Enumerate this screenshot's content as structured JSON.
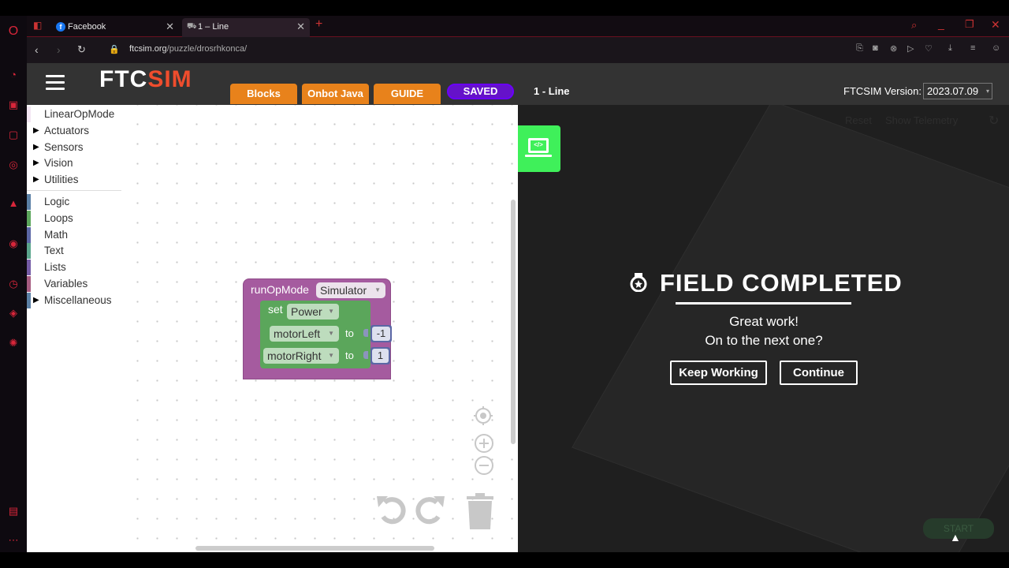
{
  "browser": {
    "tabs": [
      {
        "title": "Facebook"
      },
      {
        "title": "1 – Line"
      }
    ],
    "url_domain": "ftcsim.org",
    "url_path": "/puzzle/drosrhkonca/"
  },
  "header": {
    "logo_main": "FTC",
    "logo_accent": "SIM",
    "tabs": [
      "Blocks",
      "Onbot Java",
      "GUIDE"
    ],
    "saved_label": "SAVED",
    "level_title": "1 - Line",
    "version_label": "FTCSIM Version:",
    "version_value": "2023.07.09"
  },
  "toolbox": {
    "categories": [
      {
        "label": "LinearOpMode",
        "expandable": false,
        "color": "#f3e6f3"
      },
      {
        "label": "Actuators",
        "expandable": true,
        "color": ""
      },
      {
        "label": "Sensors",
        "expandable": true,
        "color": ""
      },
      {
        "label": "Vision",
        "expandable": true,
        "color": ""
      },
      {
        "label": "Utilities",
        "expandable": true,
        "color": ""
      },
      {
        "label": "Logic",
        "expandable": false,
        "color": "#5b80a5"
      },
      {
        "label": "Loops",
        "expandable": false,
        "color": "#5ba55b"
      },
      {
        "label": "Math",
        "expandable": false,
        "color": "#5b67a5"
      },
      {
        "label": "Text",
        "expandable": false,
        "color": "#5ba58c"
      },
      {
        "label": "Lists",
        "expandable": false,
        "color": "#745ba5"
      },
      {
        "label": "Variables",
        "expandable": false,
        "color": "#a55b80"
      },
      {
        "label": "Miscellaneous",
        "expandable": true,
        "color": "#5b80a5"
      }
    ]
  },
  "blocks": {
    "run_label": "runOpMode",
    "run_dropdown": "Simulator",
    "set_label": "set",
    "set_dropdown": "Power",
    "motor1": "motorLeft",
    "motor1_value": "-1",
    "motor2": "motorRight",
    "motor2_value": "1",
    "to_label": "to"
  },
  "field": {
    "reset_label": "Reset",
    "telemetry_label": "Show Telemetry",
    "start_label": "START",
    "completed_title": "FIELD COMPLETED",
    "message_line1": "Great work!",
    "message_line2": "On to the next one?",
    "keep_working_label": "Keep Working",
    "continue_label": "Continue"
  },
  "colors": {
    "accent_orange": "#e8821b",
    "saved_purple": "#6512c9",
    "brand_red": "#ef4d2d",
    "code_green": "#3ff05a"
  }
}
